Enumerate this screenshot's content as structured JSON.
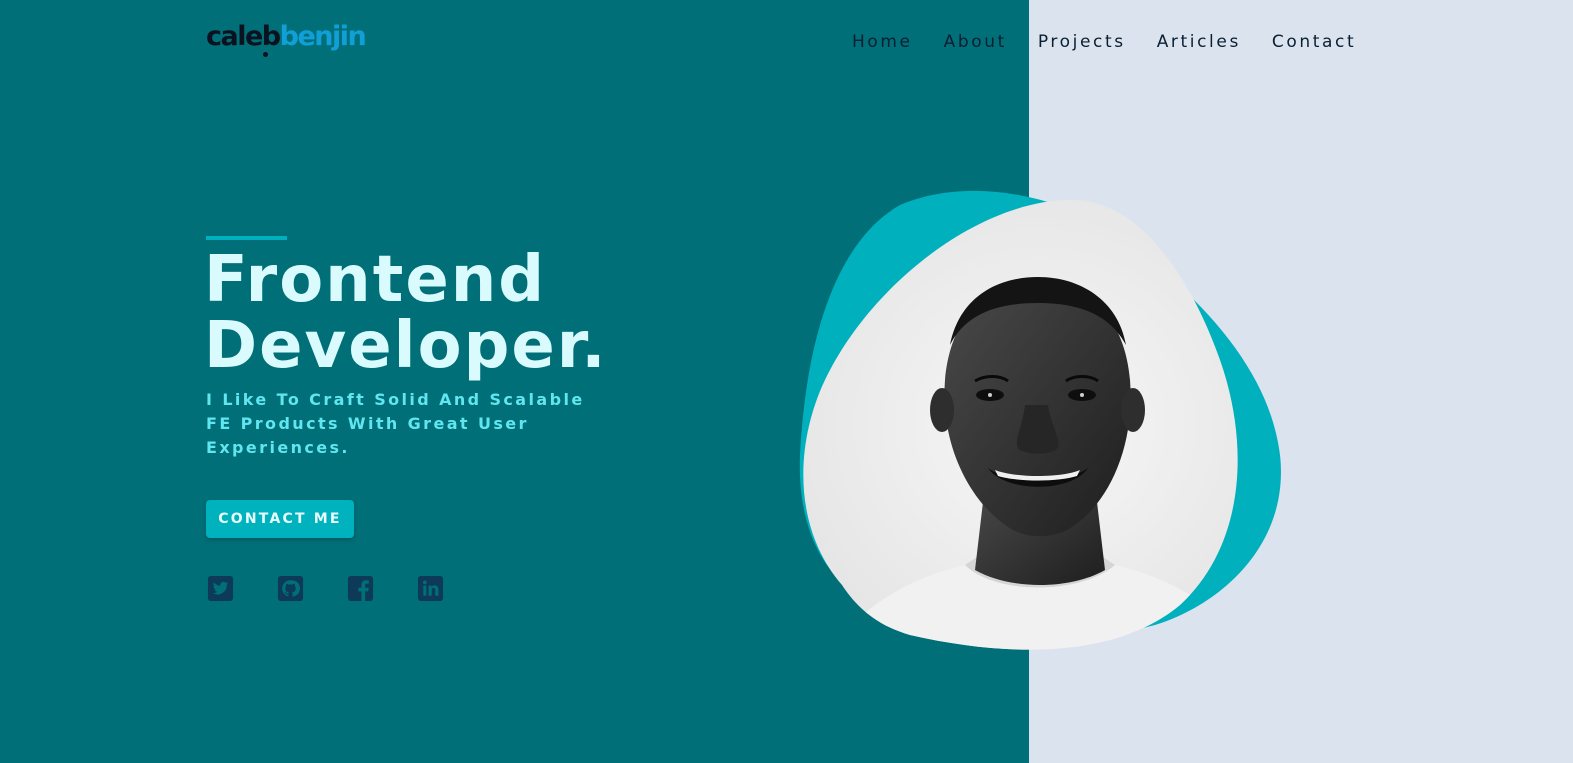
{
  "logo": {
    "part1": "caleb",
    "part2": "benjin"
  },
  "nav": {
    "items": [
      {
        "label": "Home"
      },
      {
        "label": "About"
      },
      {
        "label": "Projects"
      },
      {
        "label": "Articles"
      },
      {
        "label": "Contact"
      }
    ]
  },
  "hero": {
    "title_line1": "Frontend",
    "title_line2": "Developer.",
    "tagline": "I Like To Craft Solid And Scalable FE Products With Great User Experiences.",
    "cta_label": "CONTACT ME"
  },
  "socials": [
    {
      "icon": "twitter-icon"
    },
    {
      "icon": "github-icon"
    },
    {
      "icon": "facebook-icon"
    },
    {
      "icon": "linkedin-icon"
    }
  ],
  "colors": {
    "left_bg": "#006f78",
    "right_bg": "#dae3ee",
    "accent": "#00b0bc",
    "headline": "#d9fbfd",
    "tagline": "#5fe6f0",
    "social_icon": "#0c3a57",
    "logo_dark": "#0a1220",
    "logo_blue": "#119fd8"
  },
  "portrait": {
    "icon": "profile-portrait"
  }
}
